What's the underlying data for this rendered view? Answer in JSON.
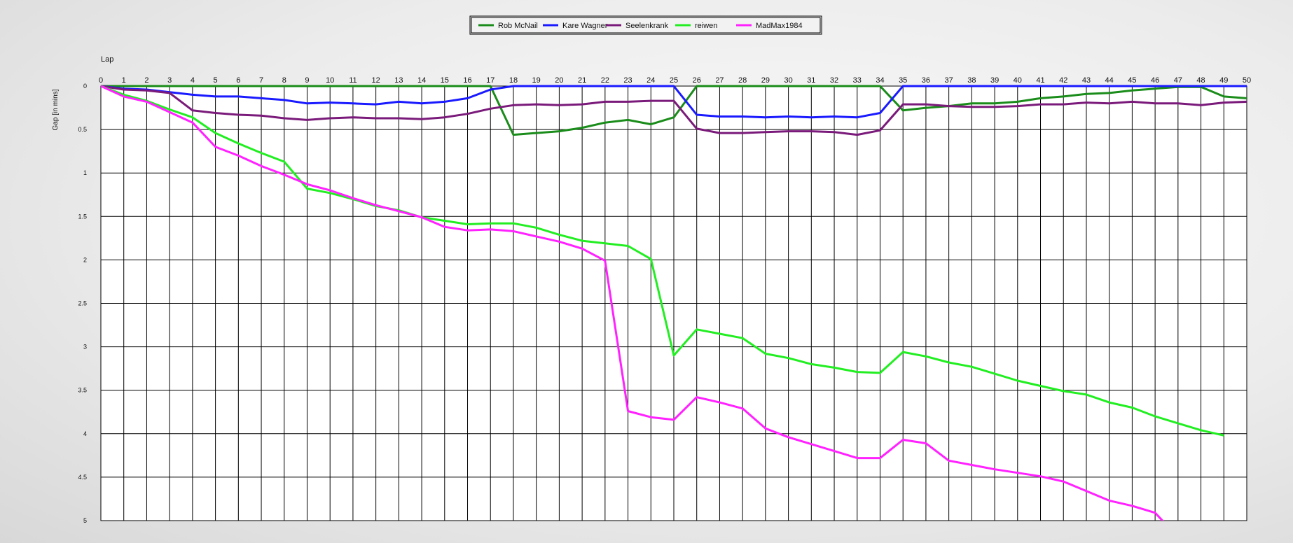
{
  "chart_data": {
    "type": "line",
    "xlabel": "Lap",
    "ylabel": "Gap [in mins]",
    "x": [
      0,
      1,
      2,
      3,
      4,
      5,
      6,
      7,
      8,
      9,
      10,
      11,
      12,
      13,
      14,
      15,
      16,
      17,
      18,
      19,
      20,
      21,
      22,
      23,
      24,
      25,
      26,
      27,
      28,
      29,
      30,
      31,
      32,
      33,
      34,
      35,
      36,
      37,
      38,
      39,
      40,
      41,
      42,
      43,
      44,
      45,
      46,
      47,
      48,
      49,
      50
    ],
    "xlim": [
      0,
      50
    ],
    "ylim": [
      0,
      5
    ],
    "y_inverted": true,
    "y_ticks": [
      0,
      0.5,
      1,
      1.5,
      2,
      2.5,
      3,
      3.5,
      4,
      4.5,
      5
    ],
    "grid": true,
    "legend_position": "top-center",
    "series": [
      {
        "name": "Rob McNail",
        "color": "#1a8c1a",
        "values": [
          0,
          0,
          0,
          0,
          0,
          0,
          0,
          0,
          0,
          0,
          0,
          0,
          0,
          0,
          0,
          0,
          0,
          0,
          0.56,
          0.54,
          0.52,
          0.48,
          0.42,
          0.39,
          0.44,
          0.36,
          0,
          0,
          0,
          0,
          0,
          0,
          0,
          0,
          0,
          0.28,
          0.25,
          0.23,
          0.2,
          0.2,
          0.18,
          0.14,
          0.12,
          0.09,
          0.08,
          0.05,
          0.03,
          0.01,
          0.01,
          0.12,
          0.14
        ]
      },
      {
        "name": "Kare Wagner",
        "color": "#1a1aff",
        "values": [
          0,
          0.03,
          0.04,
          0.07,
          0.1,
          0.12,
          0.12,
          0.14,
          0.16,
          0.2,
          0.19,
          0.2,
          0.21,
          0.18,
          0.2,
          0.18,
          0.14,
          0.04,
          0,
          0,
          0,
          0,
          0,
          0,
          0,
          0,
          0.33,
          0.35,
          0.35,
          0.36,
          0.35,
          0.36,
          0.35,
          0.36,
          0.31,
          0,
          0,
          0,
          0,
          0,
          0,
          0,
          0,
          0,
          0,
          0,
          0,
          0,
          0,
          0,
          0
        ]
      },
      {
        "name": "Seelenkrank",
        "color": "#7a1a7a",
        "values": [
          0,
          0.04,
          0.05,
          0.08,
          0.28,
          0.31,
          0.33,
          0.34,
          0.37,
          0.39,
          0.37,
          0.36,
          0.37,
          0.37,
          0.38,
          0.36,
          0.32,
          0.26,
          0.22,
          0.21,
          0.22,
          0.21,
          0.18,
          0.18,
          0.17,
          0.17,
          0.49,
          0.54,
          0.54,
          0.53,
          0.52,
          0.52,
          0.53,
          0.56,
          0.51,
          0.21,
          0.21,
          0.23,
          0.24,
          0.24,
          0.23,
          0.21,
          0.21,
          0.19,
          0.2,
          0.18,
          0.2,
          0.2,
          0.22,
          0.19,
          0.18
        ]
      },
      {
        "name": "reiwen",
        "color": "#22ee22",
        "values": [
          0,
          0.1,
          0.17,
          0.27,
          0.36,
          0.54,
          0.66,
          0.77,
          0.87,
          1.18,
          1.23,
          1.3,
          1.38,
          1.43,
          1.51,
          1.55,
          1.59,
          1.58,
          1.58,
          1.63,
          1.71,
          1.78,
          1.81,
          1.84,
          1.99,
          3.1,
          2.8,
          2.85,
          2.9,
          3.08,
          3.13,
          3.2,
          3.24,
          3.29,
          3.3,
          3.06,
          3.11,
          3.18,
          3.23,
          3.31,
          3.39,
          3.45,
          3.51,
          3.55,
          3.64,
          3.7,
          3.8,
          3.88,
          3.96,
          4.02,
          null
        ]
      },
      {
        "name": "MadMax1984",
        "color": "#ff22ff",
        "values": [
          0,
          0.12,
          0.18,
          0.3,
          0.42,
          0.7,
          0.8,
          0.92,
          1.02,
          1.13,
          1.2,
          1.29,
          1.37,
          1.44,
          1.51,
          1.62,
          1.66,
          1.65,
          1.67,
          1.73,
          1.79,
          1.87,
          2.01,
          3.74,
          3.81,
          3.84,
          3.58,
          3.64,
          3.71,
          3.94,
          4.04,
          4.12,
          4.2,
          4.28,
          4.28,
          4.07,
          4.11,
          4.31,
          4.36,
          4.41,
          4.45,
          4.49,
          4.55,
          4.66,
          4.77,
          4.83,
          4.91,
          5.19,
          null,
          null,
          null
        ]
      }
    ]
  }
}
